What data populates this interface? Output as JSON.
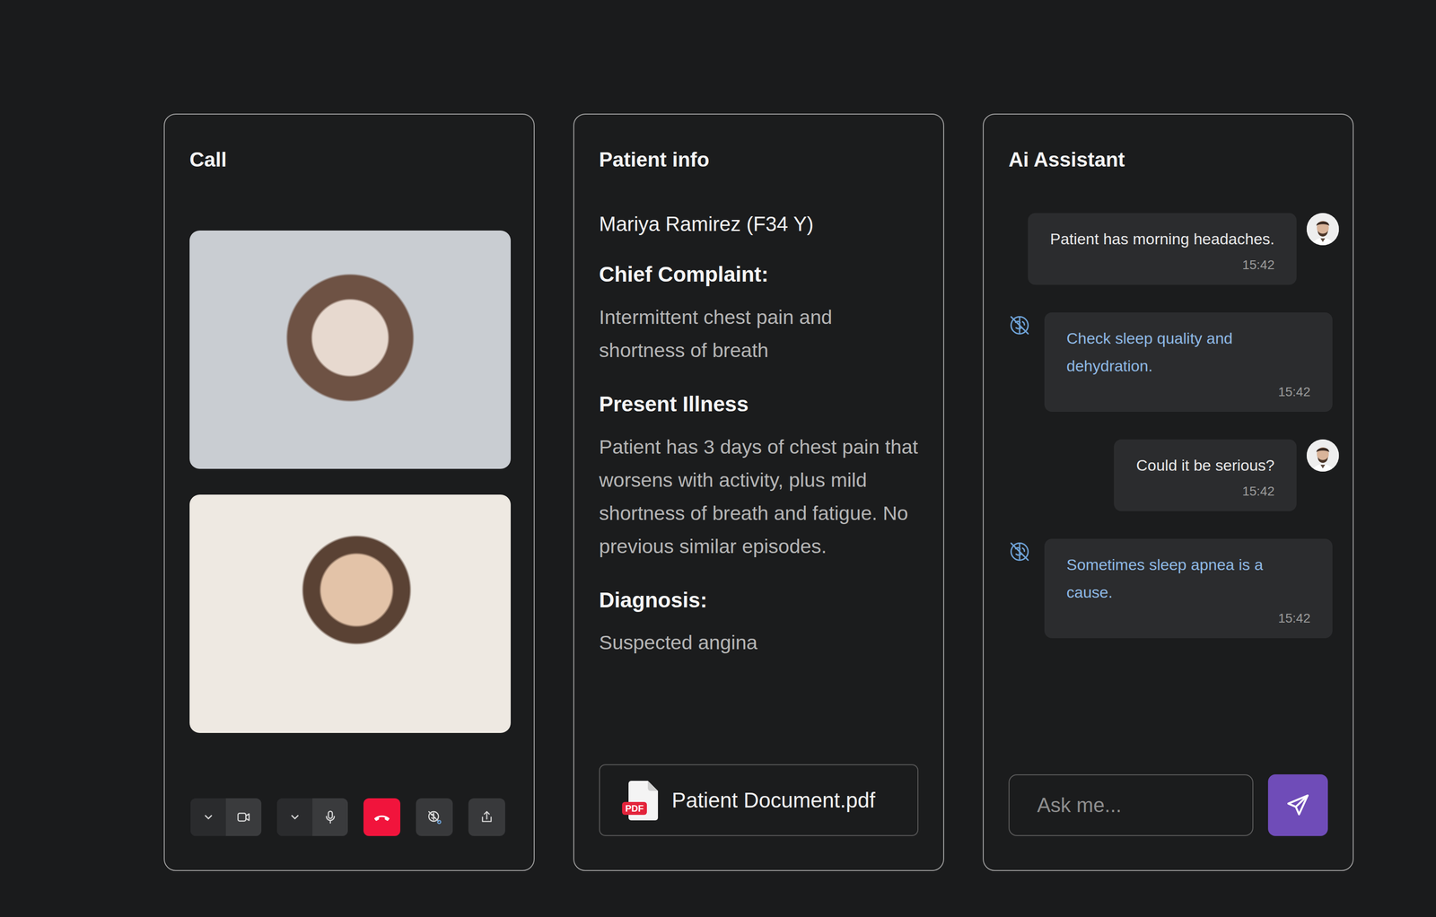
{
  "call": {
    "title": "Call",
    "videos": [
      {
        "kind": "doctor"
      },
      {
        "kind": "patient"
      }
    ],
    "controls": [
      {
        "kind": "camera"
      },
      {
        "kind": "microphone"
      },
      {
        "kind": "end-call"
      },
      {
        "kind": "ai"
      },
      {
        "kind": "share"
      }
    ]
  },
  "patient": {
    "title": "Patient info",
    "name": "Mariya Ramirez (F34 Y)",
    "sections": [
      {
        "heading": "Chief Complaint:",
        "text": "Intermittent chest pain and shortness of breath"
      },
      {
        "heading": "Present Illness",
        "text": "Patient has 3 days of chest pain that worsens with activity, plus mild shortness of breath and fatigue. No previous similar episodes."
      },
      {
        "heading": "Diagnosis:",
        "text": "Suspected angina"
      }
    ],
    "document": {
      "badge": "PDF",
      "filename": "Patient Document.pdf"
    }
  },
  "assistant": {
    "title": "Ai Assistant",
    "messages": [
      {
        "kind": "user",
        "text": "Patient has morning headaches.",
        "time": "15:42"
      },
      {
        "kind": "bot",
        "text": "Check sleep quality and dehydration.",
        "time": "15:42"
      },
      {
        "kind": "user",
        "text": "Could it be serious?",
        "time": "15:42"
      },
      {
        "kind": "bot",
        "text": "Sometimes sleep apnea is a cause.",
        "time": "15:42"
      }
    ],
    "input": {
      "placeholder": "Ask me..."
    }
  }
}
